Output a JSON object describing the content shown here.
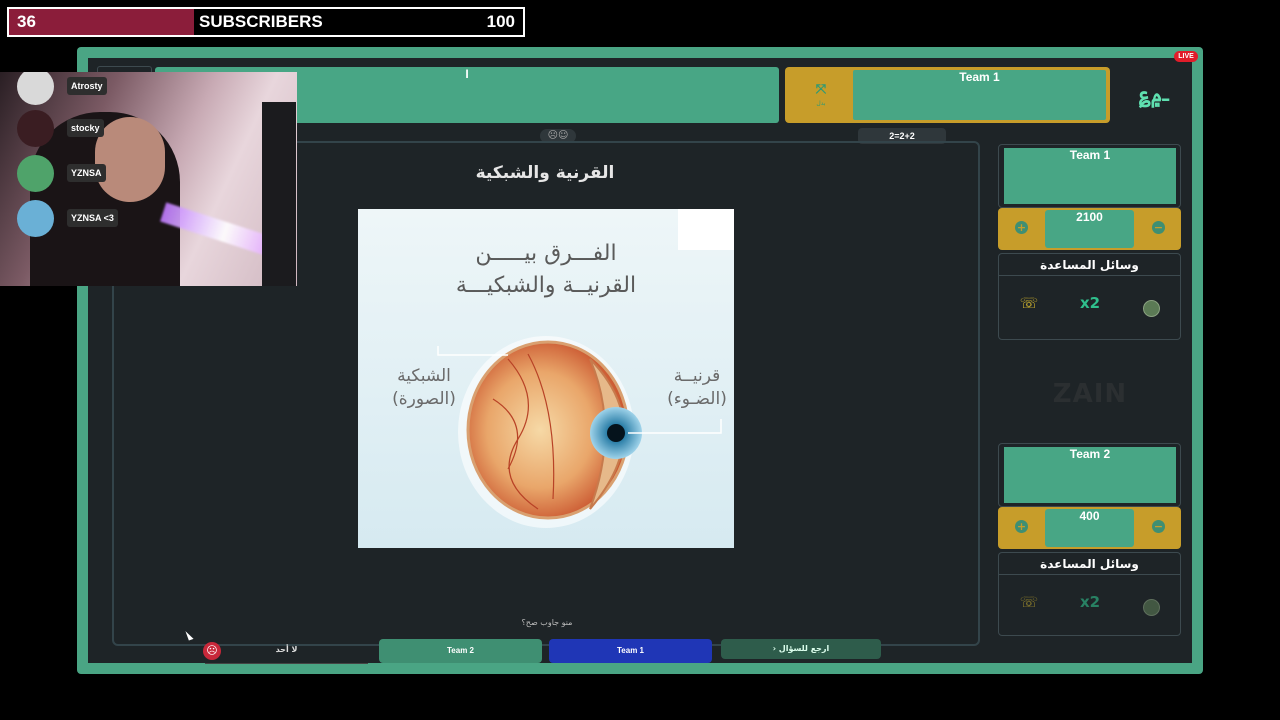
{
  "subscriber_bar": {
    "count": "36",
    "label": "SUBSCRIBERS",
    "goal": "100",
    "progress_fraction": 0.36
  },
  "live_badge": "LIVE",
  "question_bar": {
    "text": "I"
  },
  "current_team_banner": {
    "icon_caption": "بدل",
    "team_name": "Team 1"
  },
  "formula_pill": "2=2+2",
  "question": {
    "title": "القرنية والشبكية",
    "image": {
      "heading_line1": "الفـــرق بيـــــن",
      "heading_line2": "القرنيــة والشبكيـــة",
      "label_left_line1": "الشبكية",
      "label_left_line2": "(الصورة)",
      "label_right_line1": "قرنيــة",
      "label_right_line2": "(الضـوء)"
    },
    "who_answered": "منو جاوب صح؟"
  },
  "bottom_buttons": {
    "none": "لا أحد",
    "team2": "Team 2",
    "team1": "Team 1",
    "back": "ارجع للسؤال"
  },
  "teams": [
    {
      "name": "Team 1",
      "score": "2100",
      "aids_label": "وسائل المساعدة",
      "aid_x2": "x2"
    },
    {
      "name": "Team 2",
      "score": "400",
      "aids_label": "وسائل المساعدة",
      "aid_x2": "x2"
    }
  ],
  "sponsor": "ZAIN",
  "viewers": [
    {
      "name": "Atrosty"
    },
    {
      "name": "stocky"
    },
    {
      "name": "YZNSA"
    },
    {
      "name": "YZNSA <3"
    }
  ],
  "colors": {
    "frame": "#4aa584",
    "gold": "#c79d2a",
    "team1_button": "#1f36b6",
    "subscriber_fill": "#8b1d3a"
  }
}
